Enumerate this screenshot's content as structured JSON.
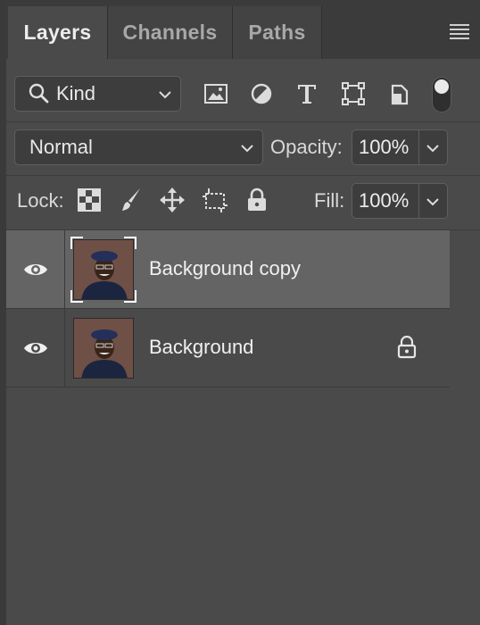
{
  "tabs": [
    {
      "label": "Layers",
      "active": true
    },
    {
      "label": "Channels",
      "active": false
    },
    {
      "label": "Paths",
      "active": false
    }
  ],
  "filter": {
    "kind_label": "Kind",
    "filter_icons": [
      "image-filter-icon",
      "adjustment-filter-icon",
      "type-filter-icon",
      "shape-filter-icon",
      "smart-object-filter-icon"
    ],
    "toggle_on": true
  },
  "blend": {
    "mode": "Normal",
    "opacity_label": "Opacity:",
    "opacity_value": "100%"
  },
  "lock": {
    "label": "Lock:",
    "icons": [
      "lock-transparent-pixels-icon",
      "lock-image-pixels-icon",
      "lock-position-icon",
      "lock-artboard-icon",
      "lock-all-icon"
    ],
    "fill_label": "Fill:",
    "fill_value": "100%"
  },
  "layers": [
    {
      "name": "Background copy",
      "visible": true,
      "selected": true,
      "locked": false
    },
    {
      "name": "Background",
      "visible": true,
      "selected": false,
      "locked": true
    }
  ],
  "colors": {
    "panel_bg": "#4a4a4a",
    "selected_row": "#646464",
    "tab_bar": "#3b3b3b"
  }
}
